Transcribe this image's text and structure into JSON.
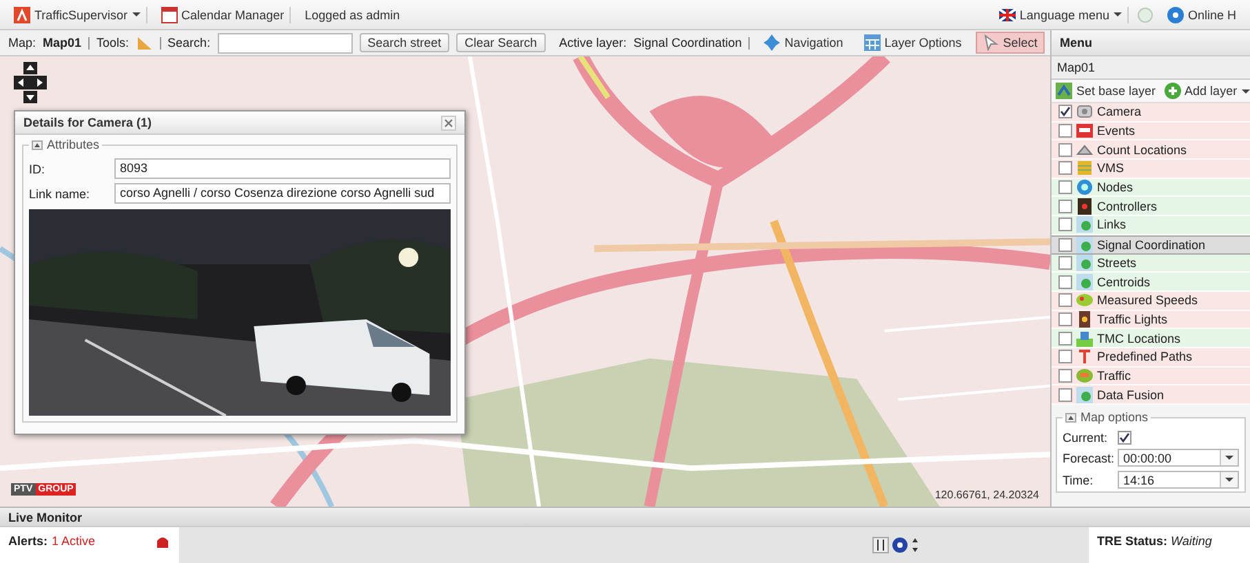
{
  "top_bar": {
    "app_menu": "TrafficSupervisor",
    "calendar": "Calendar Manager",
    "user": "Logged as admin",
    "language_menu": "Language menu",
    "help": "Online H"
  },
  "toolbar": {
    "map_label": "Map:",
    "map_name": "Map01",
    "tools_label": "Tools:",
    "search_label": "Search:",
    "buttons": [
      "Search street",
      "Clear Search"
    ],
    "active_layer_label": "Active layer:",
    "active_layer": "Signal Coordination",
    "modes": [
      {
        "label": "Navigation",
        "kind": "navigation",
        "selected": false
      },
      {
        "label": "Layer Options",
        "kind": "options",
        "selected": false
      },
      {
        "label": "Select",
        "kind": "select",
        "selected": true
      }
    ]
  },
  "dialog": {
    "title": "Details for Camera (1)",
    "legend": "Attributes",
    "fields": [
      {
        "label": "ID:",
        "value": "8093"
      },
      {
        "label": "Link name:",
        "value": "corso Agnelli / corso Cosenza direzione corso Agnelli sud"
      }
    ]
  },
  "map": {
    "coordinates": "120.66761, 24.20324",
    "logo": [
      "PTV",
      "GROUP"
    ]
  },
  "menu": {
    "title": "Menu",
    "map_name": "Map01",
    "actions": [
      {
        "label": "Set base layer",
        "kind": "base"
      },
      {
        "label": "Add layer",
        "kind": "add"
      }
    ],
    "layers": [
      {
        "label": "Camera",
        "kind": "camera",
        "checked": true,
        "selected": false,
        "color": "#fbe6e6"
      },
      {
        "label": "Events",
        "kind": "events",
        "checked": false,
        "selected": false,
        "color": "#fbe6e6"
      },
      {
        "label": "Count Locations",
        "kind": "count",
        "checked": false,
        "selected": false,
        "color": "#fbe6e6"
      },
      {
        "label": "VMS",
        "kind": "vms",
        "checked": false,
        "selected": false,
        "color": "#fbe6e6"
      },
      {
        "label": "Nodes",
        "kind": "nodes",
        "checked": false,
        "selected": false,
        "color": "#e6f6e6"
      },
      {
        "label": "Controllers",
        "kind": "controllers",
        "checked": false,
        "selected": false,
        "color": "#e6f6e6"
      },
      {
        "label": "Links",
        "kind": "layer",
        "checked": false,
        "selected": false,
        "color": "#e6f6e6"
      },
      {
        "label": "Signal Coordination",
        "kind": "layer",
        "checked": false,
        "selected": true,
        "color": "#dcdcdc"
      },
      {
        "label": "Streets",
        "kind": "layer",
        "checked": false,
        "selected": false,
        "color": "#e6f6e6"
      },
      {
        "label": "Centroids",
        "kind": "layer",
        "checked": false,
        "selected": false,
        "color": "#e6f6e6"
      },
      {
        "label": "Measured Speeds",
        "kind": "speeds",
        "checked": false,
        "selected": false,
        "color": "#fbe6e6"
      },
      {
        "label": "Traffic Lights",
        "kind": "lights",
        "checked": false,
        "selected": false,
        "color": "#fbe6e6"
      },
      {
        "label": "TMC Locations",
        "kind": "tmc",
        "checked": false,
        "selected": false,
        "color": "#e6f6e6"
      },
      {
        "label": "Predefined Paths",
        "kind": "paths",
        "checked": false,
        "selected": false,
        "color": "#fbe6e6"
      },
      {
        "label": "Traffic",
        "kind": "traffic",
        "checked": false,
        "selected": false,
        "color": "#fbe6e6"
      },
      {
        "label": "Data Fusion",
        "kind": "layer",
        "checked": false,
        "selected": false,
        "color": "#fbe6e6"
      }
    ],
    "map_options": {
      "legend": "Map options",
      "current": {
        "label": "Current:",
        "checked": true
      },
      "forecast": {
        "label": "Forecast:",
        "value": "00:00:00"
      },
      "time": {
        "label": "Time:",
        "value": "14:16"
      }
    }
  },
  "live_monitor": {
    "title": "Live Monitor",
    "alerts_label": "Alerts:",
    "alerts_value": "1 Active",
    "tre_label": "TRE Status:",
    "tre_value": "Waiting"
  }
}
